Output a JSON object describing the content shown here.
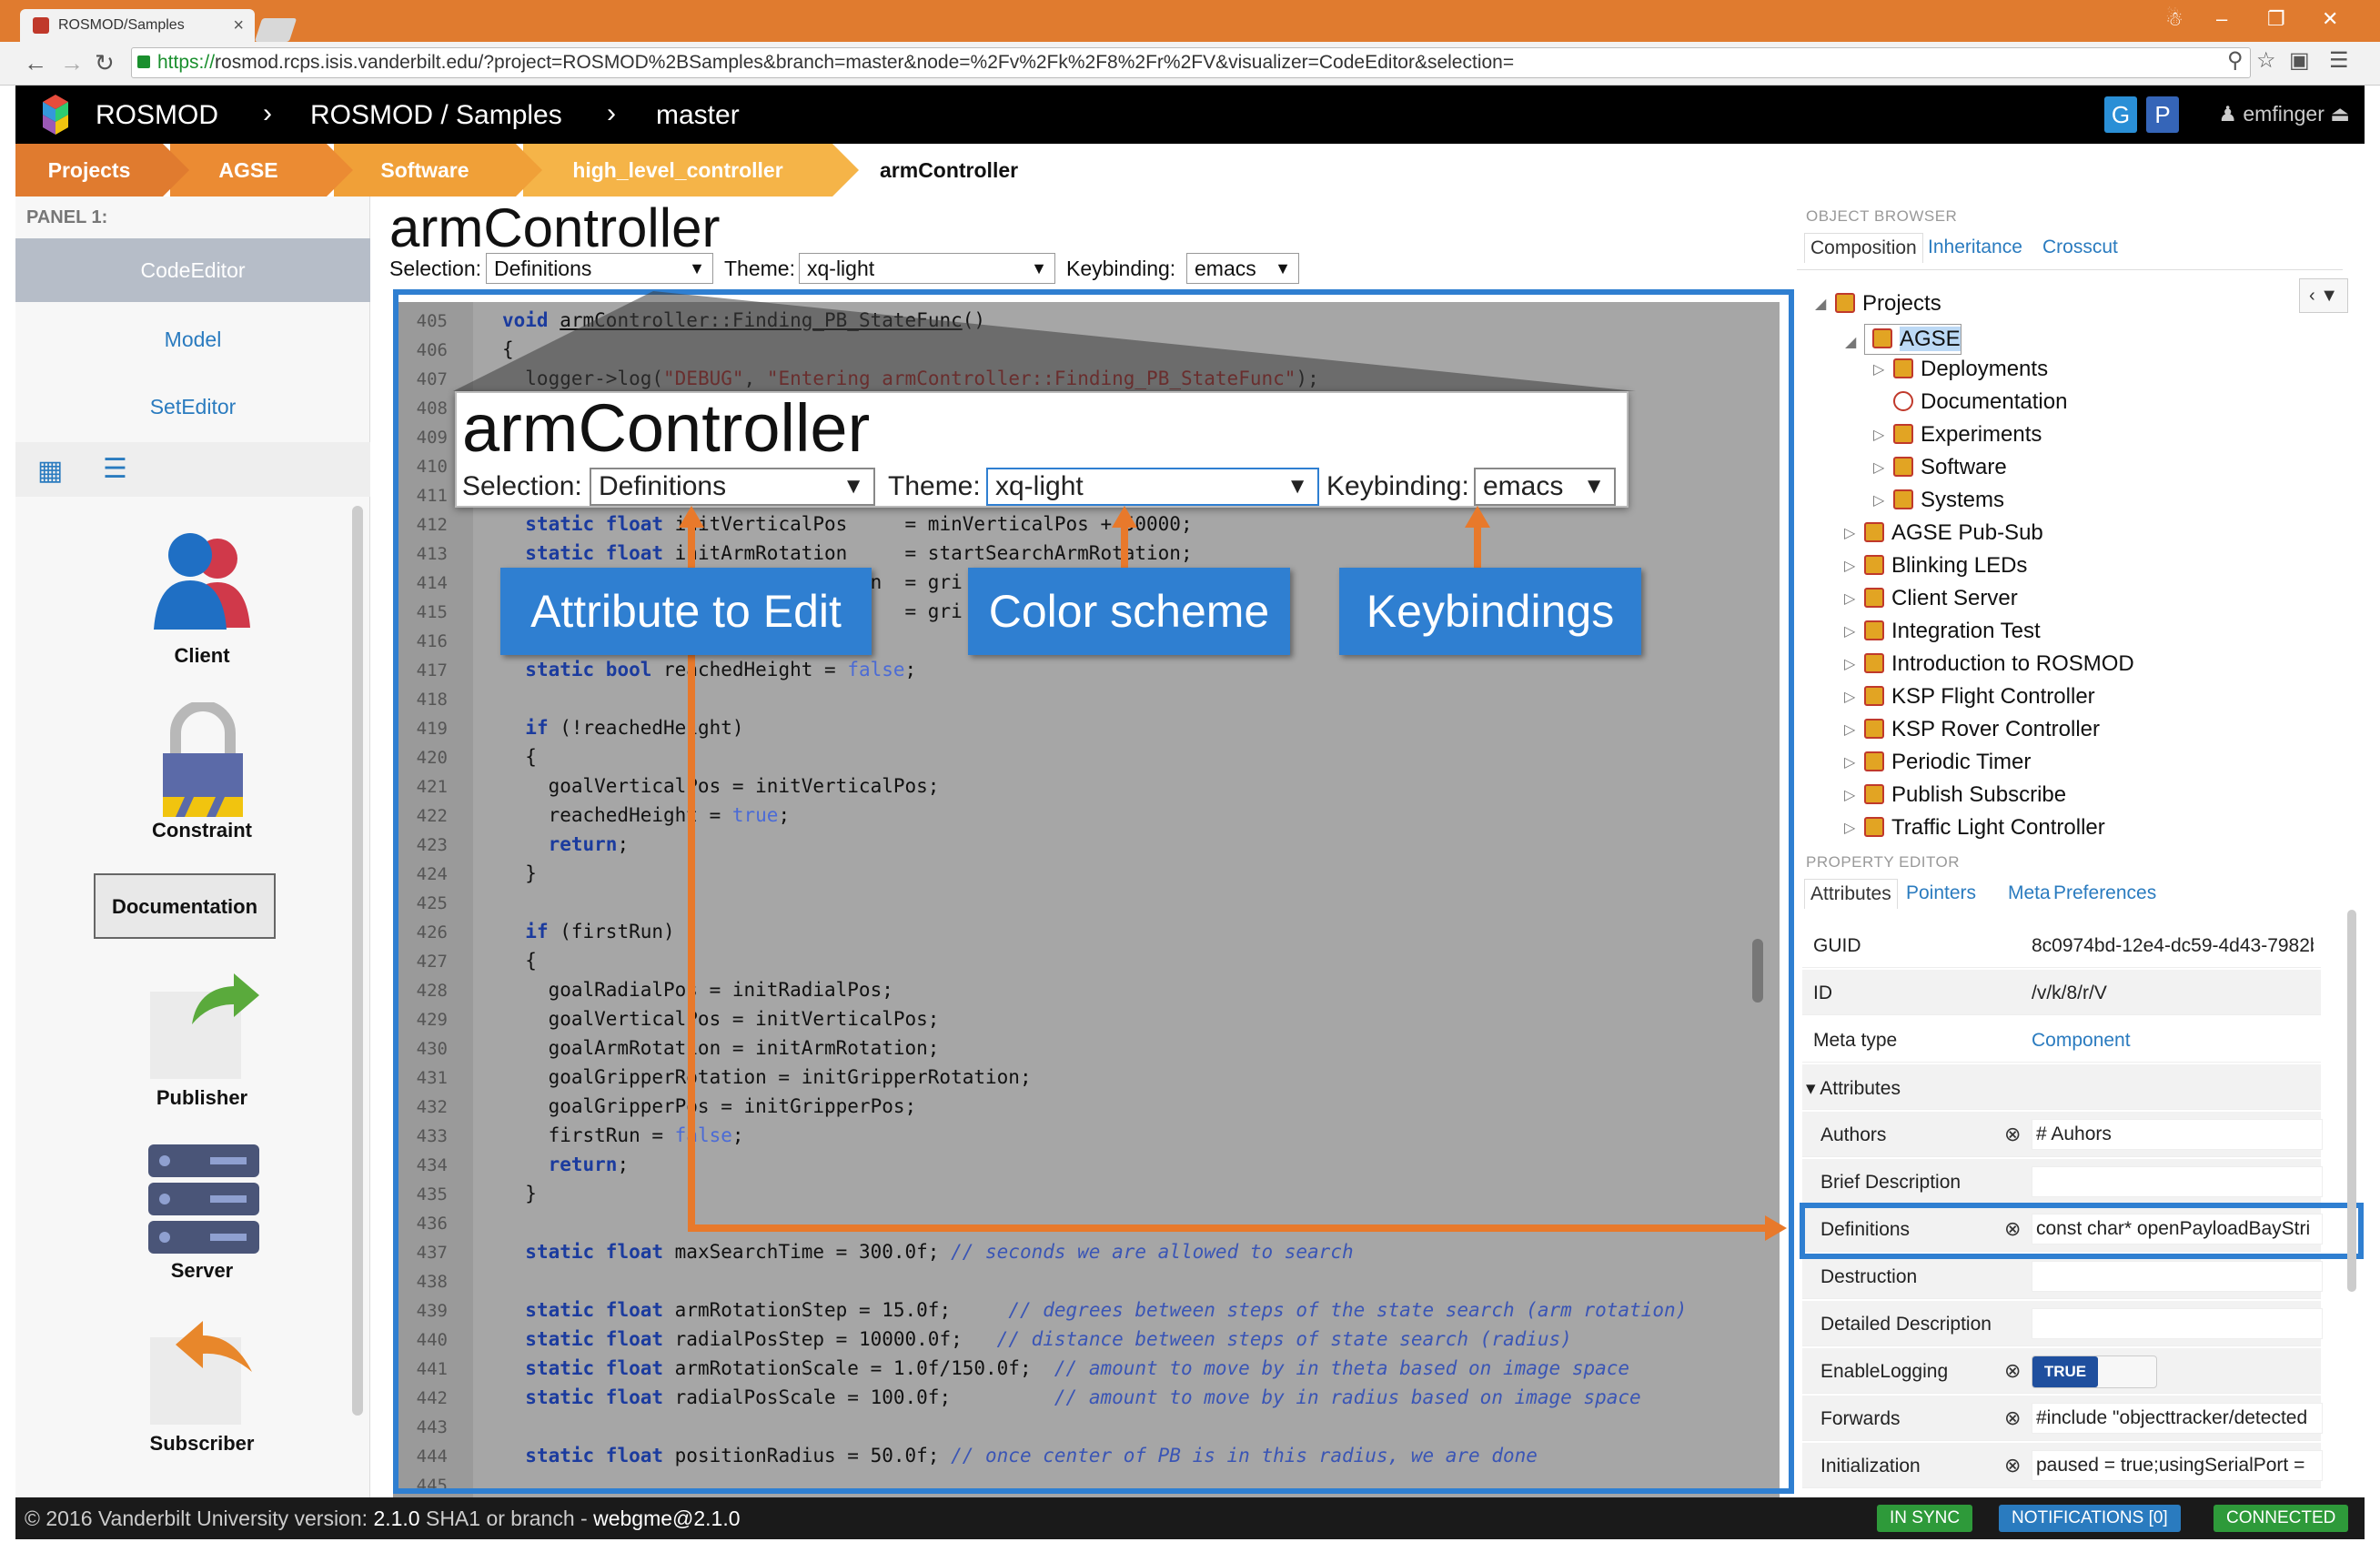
{
  "browser": {
    "tab_title": "ROSMOD/Samples",
    "tab_close": "×",
    "url_prefix": "https://",
    "url_host": "rosmod.rcps.isis.vanderbilt.edu",
    "url_path": "/?project=ROSMOD%2BSamples&branch=master&node=%2Fv%2Fk%2F8%2Fr%2FV&visualizer=CodeEditor&selection="
  },
  "header": {
    "app_name": "ROSMOD",
    "project": "ROSMOD / Samples",
    "branch": "master",
    "btn_g": "G",
    "btn_p": "P",
    "user": "emfinger"
  },
  "breadcrumbs": {
    "items": [
      "Projects",
      "AGSE",
      "Software",
      "high_level_controller"
    ],
    "current": "armController"
  },
  "left_panel": {
    "label": "PANEL 1:",
    "visualizers": [
      "CodeEditor",
      "Model",
      "SetEditor"
    ],
    "parts": [
      "Client",
      "Constraint",
      "Documentation",
      "Publisher",
      "Server",
      "Subscriber"
    ]
  },
  "editor": {
    "title": "armController",
    "selection_label": "Selection:",
    "selection_value": "Definitions",
    "theme_label": "Theme:",
    "theme_value": "xq-light",
    "keybinding_label": "Keybinding:",
    "keybinding_value": "emacs",
    "line_numbers": [
      "405",
      "406",
      "407",
      "408",
      "409",
      "410",
      "411",
      "412",
      "413",
      "414",
      "415",
      "416",
      "417",
      "418",
      "419",
      "420",
      "421",
      "422",
      "423",
      "424",
      "425",
      "426",
      "427",
      "428",
      "429",
      "430",
      "431",
      "432",
      "433",
      "434",
      "435",
      "436",
      "437",
      "438",
      "439",
      "440",
      "441",
      "442",
      "443",
      "444",
      "445"
    ]
  },
  "callouts": {
    "attribute": "Attribute to Edit",
    "color": "Color scheme",
    "keybindings": "Keybindings"
  },
  "object_browser": {
    "heading": "OBJECT BROWSER",
    "tabs": [
      "Composition",
      "Inheritance",
      "Crosscut"
    ],
    "root": "Projects",
    "selected": "AGSE",
    "children": [
      "Deployments",
      "Documentation",
      "Experiments",
      "Software",
      "Systems"
    ],
    "projects": [
      "AGSE Pub-Sub",
      "Blinking LEDs",
      "Client Server",
      "Integration Test",
      "Introduction to ROSMOD",
      "KSP Flight Controller",
      "KSP Rover Controller",
      "Periodic Timer",
      "Publish Subscribe",
      "Traffic Light Controller"
    ]
  },
  "property_editor": {
    "heading": "PROPERTY EDITOR",
    "tabs": [
      "Attributes",
      "Pointers",
      "Meta",
      "Preferences"
    ],
    "guid_key": "GUID",
    "guid_val": "8c0974bd-12e4-dc59-4d43-7982b...",
    "id_key": "ID",
    "id_val": "/v/k/8/r/V",
    "meta_key": "Meta type",
    "meta_val": "Component",
    "attr_group": "Attributes",
    "authors_key": "Authors",
    "authors_val": "# Auhors",
    "brief_key": "Brief Description",
    "definitions_key": "Definitions",
    "definitions_val": "const char* openPayloadBayStri",
    "destruction_key": "Destruction",
    "detailed_key": "Detailed Description",
    "logging_key": "EnableLogging",
    "logging_val": "TRUE",
    "forwards_key": "Forwards",
    "forwards_val": "#include \"objecttracker/detected",
    "init_key": "Initialization",
    "init_val": "paused = true;usingSerialPort ="
  },
  "footer": {
    "copyright": "© 2016 Vanderbilt University",
    "version_label": "version:",
    "version": "2.1.0",
    "sha_label": "SHA1 or branch -",
    "sha": "webgme@2.1.0",
    "sync": "IN SYNC",
    "notifications": "NOTIFICATIONS [0]",
    "connected": "CONNECTED"
  },
  "colors": {
    "accent_blue": "#2f7fd1",
    "orange": "#e8792b",
    "status_green": "#2e9a3a",
    "notif_blue": "#2a7bbf"
  }
}
